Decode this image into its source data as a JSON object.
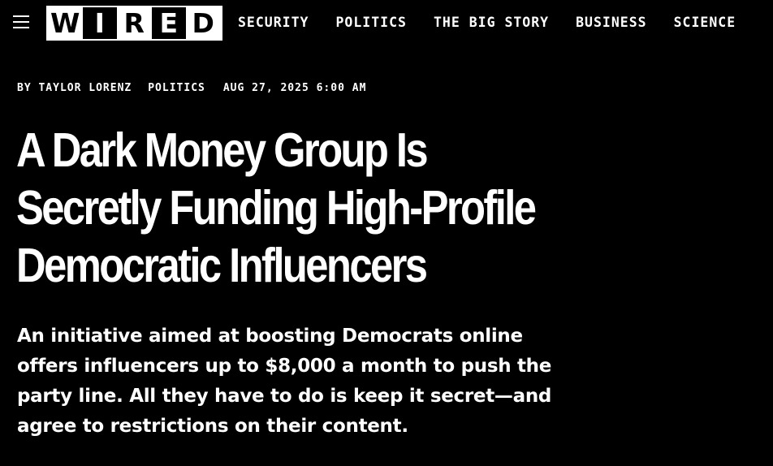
{
  "header": {
    "logo_letters": [
      "W",
      "I",
      "R",
      "E",
      "D"
    ],
    "nav": [
      "SECURITY",
      "POLITICS",
      "THE BIG STORY",
      "BUSINESS",
      "SCIENCE"
    ]
  },
  "article": {
    "byline": "BY TAYLOR LORENZ",
    "category": "POLITICS",
    "date": "AUG 27, 2025 6:00 AM",
    "headline": "A Dark Money Group Is Secretly Funding High-Profile Democratic Influencers",
    "dek": "An initiative aimed at boosting Democrats online offers influencers up to $8,000 a month to push the party line. All they have to do is keep it secret—and agree to restrictions on their content."
  },
  "colors": {
    "background": "#000000",
    "text": "#ffffff"
  },
  "icons": {
    "menu": "hamburger-menu-icon"
  }
}
